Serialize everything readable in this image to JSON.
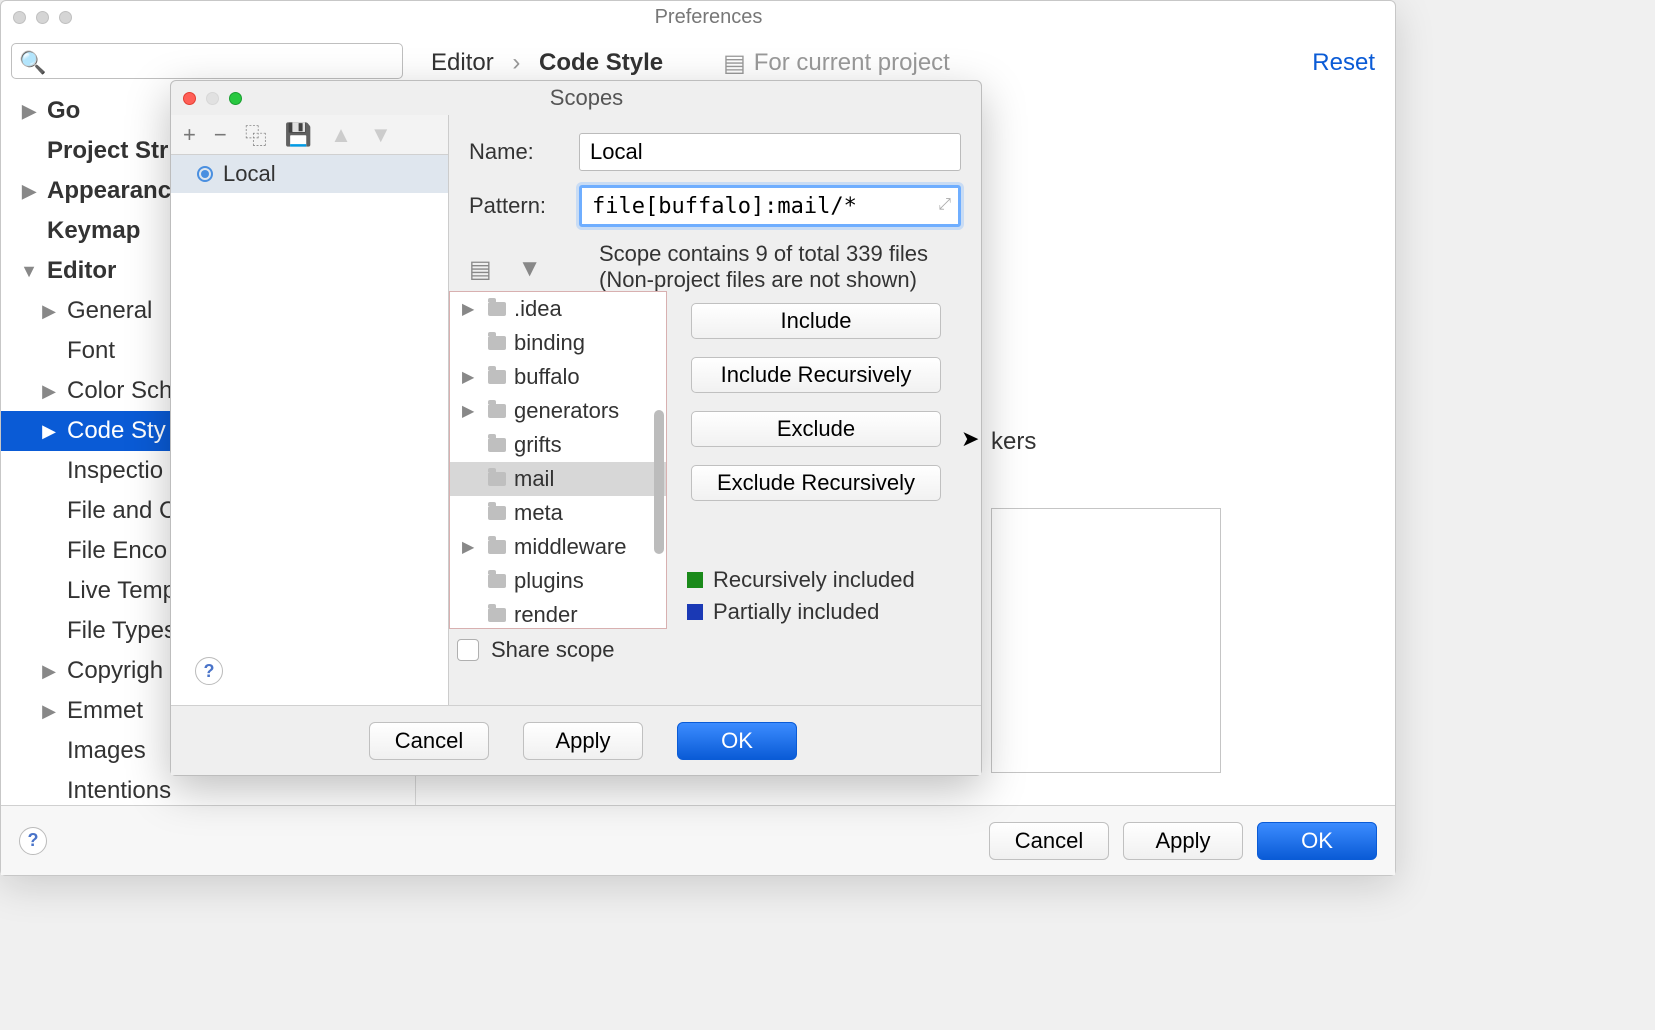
{
  "prefs": {
    "title": "Preferences",
    "reset": "Reset",
    "breadcrumb": {
      "first": "Editor",
      "sep": "›",
      "last": "Code Style"
    },
    "for_project": "For current project",
    "bg_partial": "kers",
    "sidebar": [
      {
        "label": "Go",
        "bold": true,
        "arrow": true,
        "indent": 1
      },
      {
        "label": "Project Str",
        "bold": true,
        "arrow": false,
        "indent": 1
      },
      {
        "label": "Appearance",
        "bold": true,
        "arrow": true,
        "indent": 1
      },
      {
        "label": "Keymap",
        "bold": true,
        "arrow": false,
        "indent": 1
      },
      {
        "label": "Editor",
        "bold": true,
        "arrow": true,
        "indent": 1,
        "open": true
      },
      {
        "label": "General",
        "arrow": true,
        "indent": 2
      },
      {
        "label": "Font",
        "indent": 2
      },
      {
        "label": "Color Sch",
        "arrow": true,
        "indent": 2
      },
      {
        "label": "Code Sty",
        "arrow": true,
        "indent": 2,
        "selected": true
      },
      {
        "label": "Inspectio",
        "indent": 2
      },
      {
        "label": "File and C",
        "indent": 2
      },
      {
        "label": "File Enco",
        "indent": 2
      },
      {
        "label": "Live Temp",
        "indent": 2
      },
      {
        "label": "File Types",
        "indent": 2
      },
      {
        "label": "Copyrigh",
        "arrow": true,
        "indent": 2
      },
      {
        "label": "Emmet",
        "arrow": true,
        "indent": 2
      },
      {
        "label": "Images",
        "indent": 2
      },
      {
        "label": "Intentions",
        "indent": 2
      }
    ],
    "footer": {
      "cancel": "Cancel",
      "apply": "Apply",
      "ok": "OK"
    }
  },
  "scopes": {
    "title": "Scopes",
    "toolbar": [
      "+",
      "−",
      "⿻",
      "💾",
      "▲",
      "▼"
    ],
    "list_item": "Local",
    "name_label": "Name:",
    "name_value": "Local",
    "pattern_label": "Pattern:",
    "pattern_value": "file[buffalo]:mail/*",
    "info": "Scope contains 9 of total 339 files\n(Non-project files are not shown)",
    "tree": [
      {
        "label": ".idea",
        "arrow": true
      },
      {
        "label": "binding"
      },
      {
        "label": "buffalo",
        "arrow": true
      },
      {
        "label": "generators",
        "arrow": true
      },
      {
        "label": "grifts"
      },
      {
        "label": "mail",
        "selected": true
      },
      {
        "label": "meta"
      },
      {
        "label": "middleware",
        "arrow": true
      },
      {
        "label": "plugins"
      },
      {
        "label": "render"
      }
    ],
    "buttons": {
      "include": "Include",
      "include_rec": "Include Recursively",
      "exclude": "Exclude",
      "exclude_rec": "Exclude Recursively"
    },
    "legend": {
      "rec": "Recursively included",
      "part": "Partially included"
    },
    "share": "Share scope",
    "footer": {
      "cancel": "Cancel",
      "apply": "Apply",
      "ok": "OK"
    }
  }
}
